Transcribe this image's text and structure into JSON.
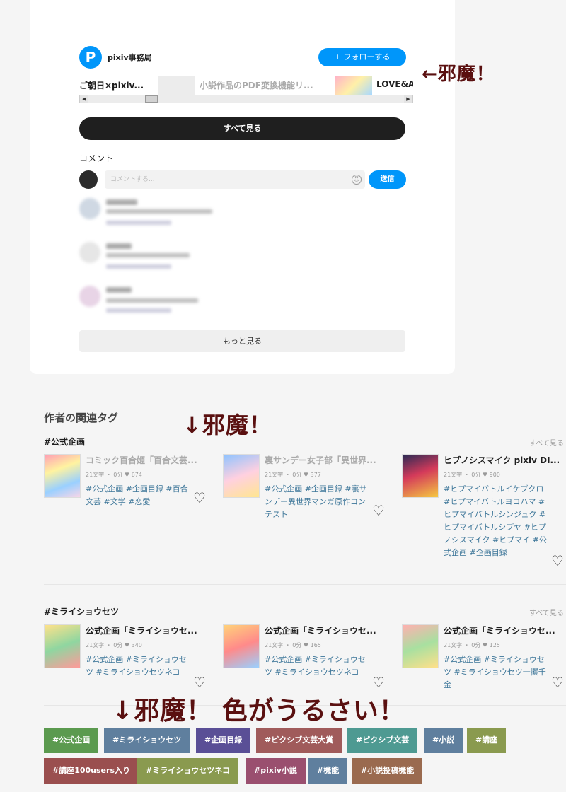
{
  "author": {
    "logo_letter": "P",
    "name": "pixiv事務局",
    "follow_label": "+ フォローする"
  },
  "strip": {
    "items": [
      "ご朝日×pixiv...",
      "小説作品のPDF変換機能リ...",
      "LOVE&A"
    ]
  },
  "see_all_label": "すべて見る",
  "comments": {
    "title": "コメント",
    "placeholder": "コメントする...",
    "send_label": "送信",
    "more_label": "もっと見る"
  },
  "notes": {
    "n1": "←邪魔！",
    "n2": "↓邪魔！",
    "n3": "↓邪魔！ 色がうるさい！"
  },
  "related": {
    "title": "作者の関連タグ",
    "groups": [
      {
        "title": "#公式企画",
        "see_all": "すべて見る",
        "works": [
          {
            "title": "コミック百合姫「百合文芸...",
            "meta": "21文字 ・ 0分 ♥ 674",
            "tags": "#公式企画 #企画目録 #百合文芸 #文学 #恋愛"
          },
          {
            "title": "裏サンデー女子部「異世界...",
            "meta": "21文字 ・ 0分 ♥ 377",
            "tags": "#公式企画 #企画目録 #裏サンデー異世界マンガ原作コンテスト"
          },
          {
            "title": "ヒプノシスマイク pixiv DI...",
            "meta": "21文字 ・ 0分 ♥ 900",
            "tags": "#ヒプマイバトルイケブクロ #ヒプマイバトルヨコハマ #ヒプマイバトルシンジュク #ヒプマイバトルシブヤ #ヒプノシスマイク #ヒプマイ #公式企画 #企画目録"
          }
        ]
      },
      {
        "title": "#ミライショウセツ",
        "see_all": "すべて見る",
        "works": [
          {
            "title": "公式企画「ミライショウセ...",
            "meta": "21文字 ・ 0分 ♥ 340",
            "tags": "#公式企画 #ミライショウセツ #ミライショウセツネコ"
          },
          {
            "title": "公式企画「ミライショウセ...",
            "meta": "21文字 ・ 0分 ♥ 165",
            "tags": "#公式企画 #ミライショウセツ #ミライショウセツネコ"
          },
          {
            "title": "公式企画「ミライショウセ...",
            "meta": "21文字 ・ 0分 ♥ 125",
            "tags": "#公式企画 #ミライショウセツ #ミライショウセツ一攫千金"
          }
        ]
      }
    ]
  },
  "tag_boxes": [
    {
      "label": "#公式企画",
      "color": "#5b9a4f"
    },
    {
      "label": "#ミライショウセツ",
      "color": "#5f7f9e"
    },
    {
      "label": "#企画目録",
      "color": "#5a4f96"
    },
    {
      "label": "#ピクシブ文芸大賞",
      "color": "#a05b5b"
    },
    {
      "label": "#ピクシブ文芸",
      "color": "#4e9a92"
    },
    {
      "label": "#小説",
      "color": "#5f7f9e"
    },
    {
      "label": "#講座",
      "color": "#8a9a4f"
    },
    {
      "label": "#講座100users入り",
      "color": "#9a4f4f"
    },
    {
      "label": "#ミライショウセツネコ",
      "color": "#8a9a4f"
    },
    {
      "label": "#pixiv小説",
      "color": "#9a4f6f"
    },
    {
      "label": "#機能",
      "color": "#5f7f9e"
    },
    {
      "label": "#小説投稿機能",
      "color": "#9a6a4f"
    }
  ]
}
